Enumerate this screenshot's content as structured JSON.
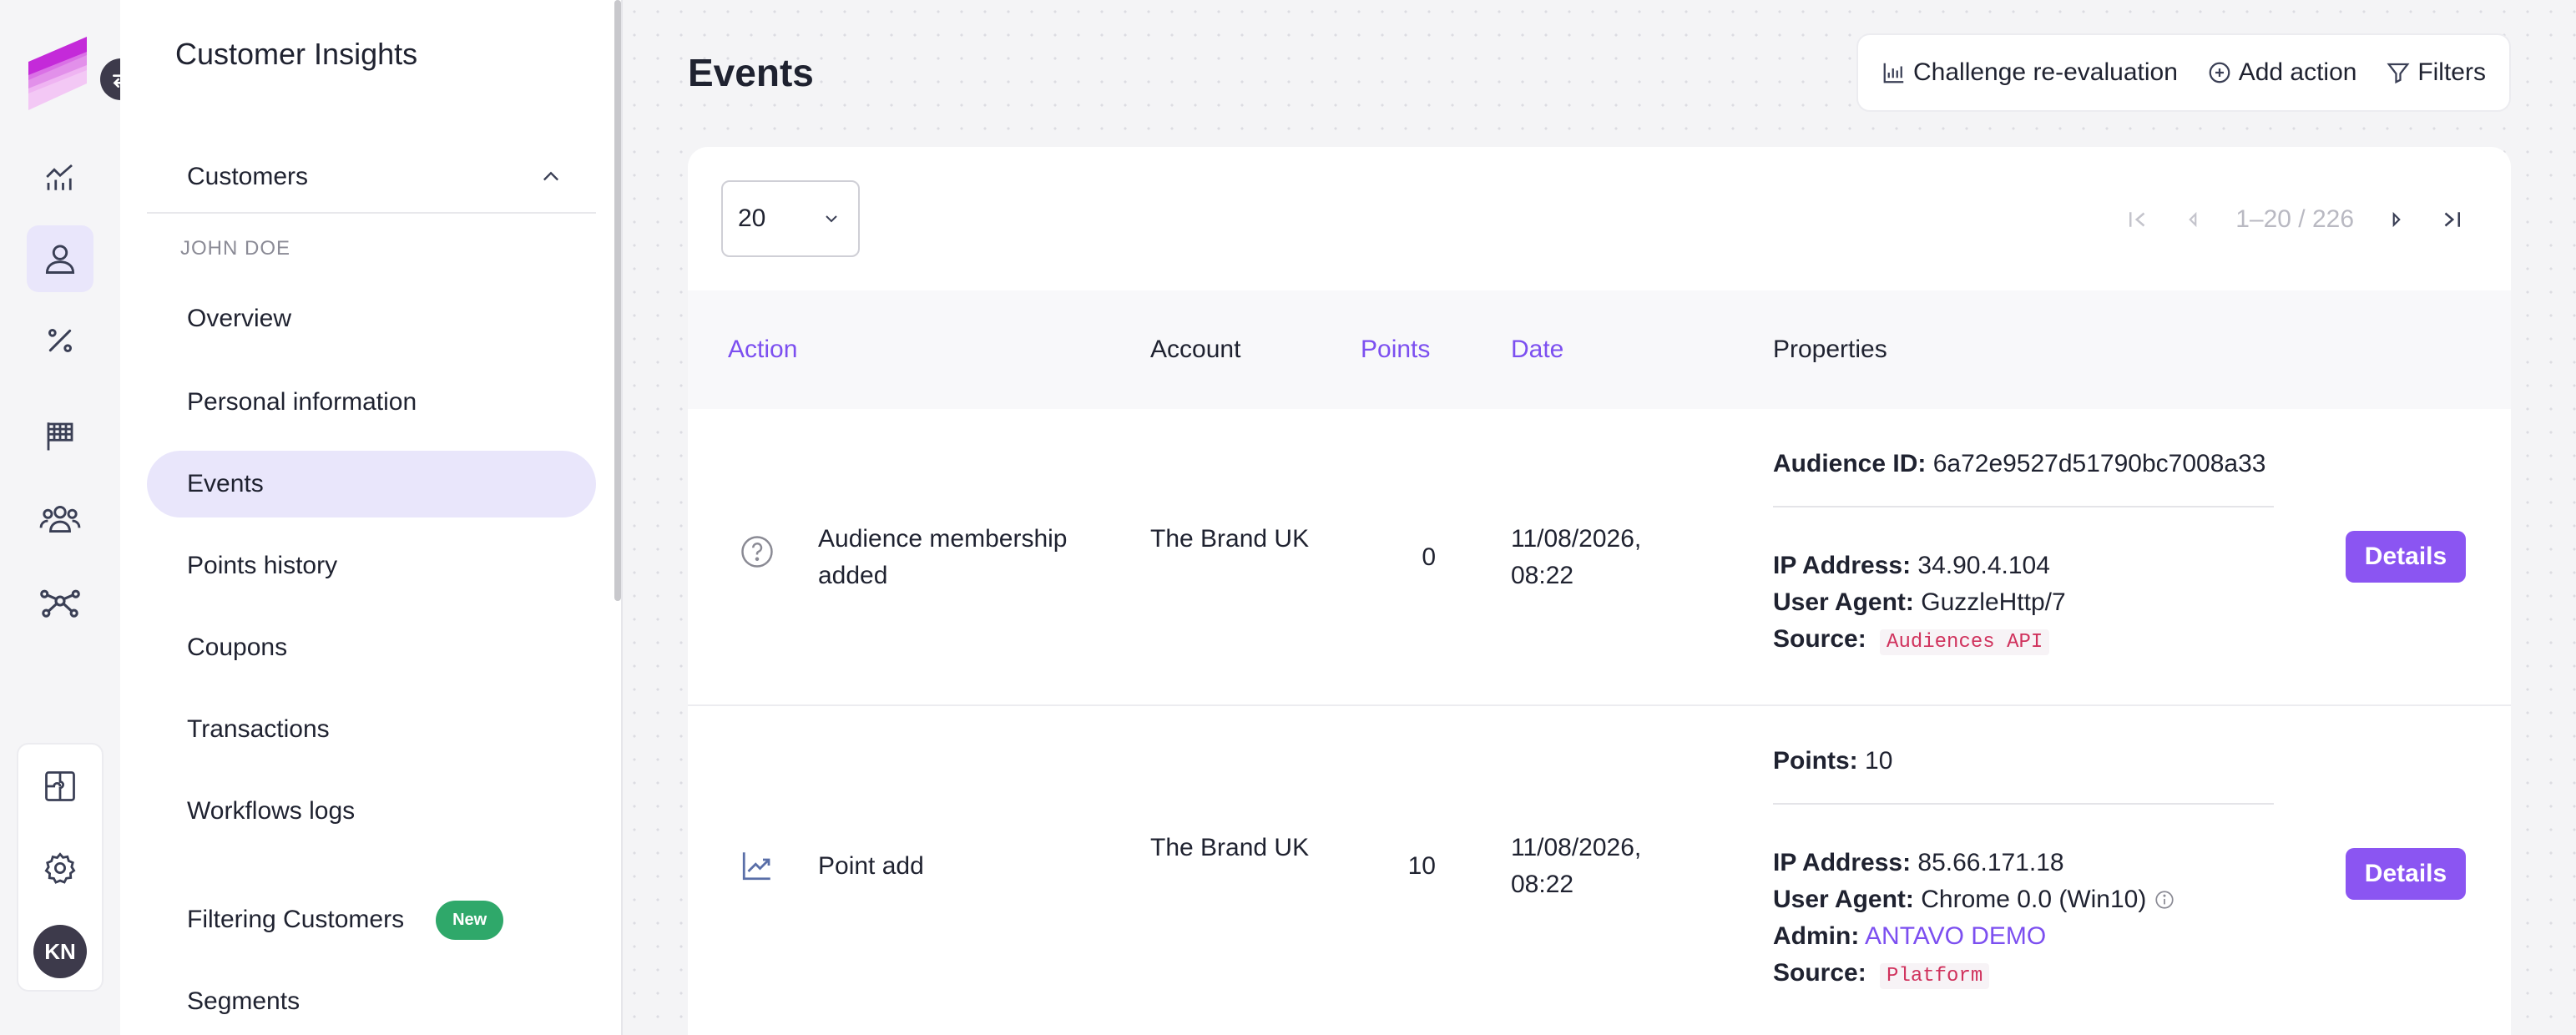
{
  "app": {
    "title": "Customer Insights"
  },
  "avatar": {
    "initials": "KN"
  },
  "sidebar": {
    "section": "Customers",
    "group_label": "JOHN DOE",
    "items": [
      {
        "label": "Overview"
      },
      {
        "label": "Personal information"
      },
      {
        "label": "Events",
        "active": true
      },
      {
        "label": "Points history"
      },
      {
        "label": "Coupons"
      },
      {
        "label": "Transactions"
      },
      {
        "label": "Workflows logs"
      },
      {
        "label": "Filtering Customers",
        "badge": "New"
      },
      {
        "label": "Segments"
      }
    ]
  },
  "page": {
    "title": "Events"
  },
  "toolbar": {
    "challenge_label": "Challenge re-evaluation",
    "add_action_label": "Add action",
    "filters_label": "Filters"
  },
  "pagination": {
    "page_size": "20",
    "range": "1–20 / 226"
  },
  "table": {
    "columns": [
      "Action",
      "Account",
      "Points",
      "Date",
      "Properties"
    ],
    "rows": [
      {
        "icon": "question-circle-icon",
        "action": "Audience membership added",
        "account": "The Brand UK",
        "points": "0",
        "date": "11/08/2026, 08:22",
        "top_prop_label": "Audience ID:",
        "top_prop_value": "6a72e9527d51790bc7008a33",
        "ip_label": "IP Address:",
        "ip_value": "34.90.4.104",
        "ua_label": "User Agent:",
        "ua_value": "GuzzleHttp/7",
        "source_label": "Source:",
        "source_value": "Audiences API",
        "details_label": "Details"
      },
      {
        "icon": "trending-up-icon",
        "action": "Point add",
        "account": "The Brand UK",
        "points": "10",
        "date": "11/08/2026, 08:22",
        "top_prop_label": "Points:",
        "top_prop_value": "10",
        "ip_label": "IP Address:",
        "ip_value": "85.66.171.18",
        "ua_label": "User Agent:",
        "ua_value": "Chrome 0.0 (Win10)",
        "admin_label": "Admin:",
        "admin_value": "ANTAVO DEMO",
        "source_label": "Source:",
        "source_value": "Platform",
        "details_label": "Details"
      }
    ]
  },
  "colors": {
    "accent": "#8b55f2",
    "active_bg": "#e9e6fb",
    "badge_green": "#2fa86a",
    "code_red": "#d0325d"
  }
}
